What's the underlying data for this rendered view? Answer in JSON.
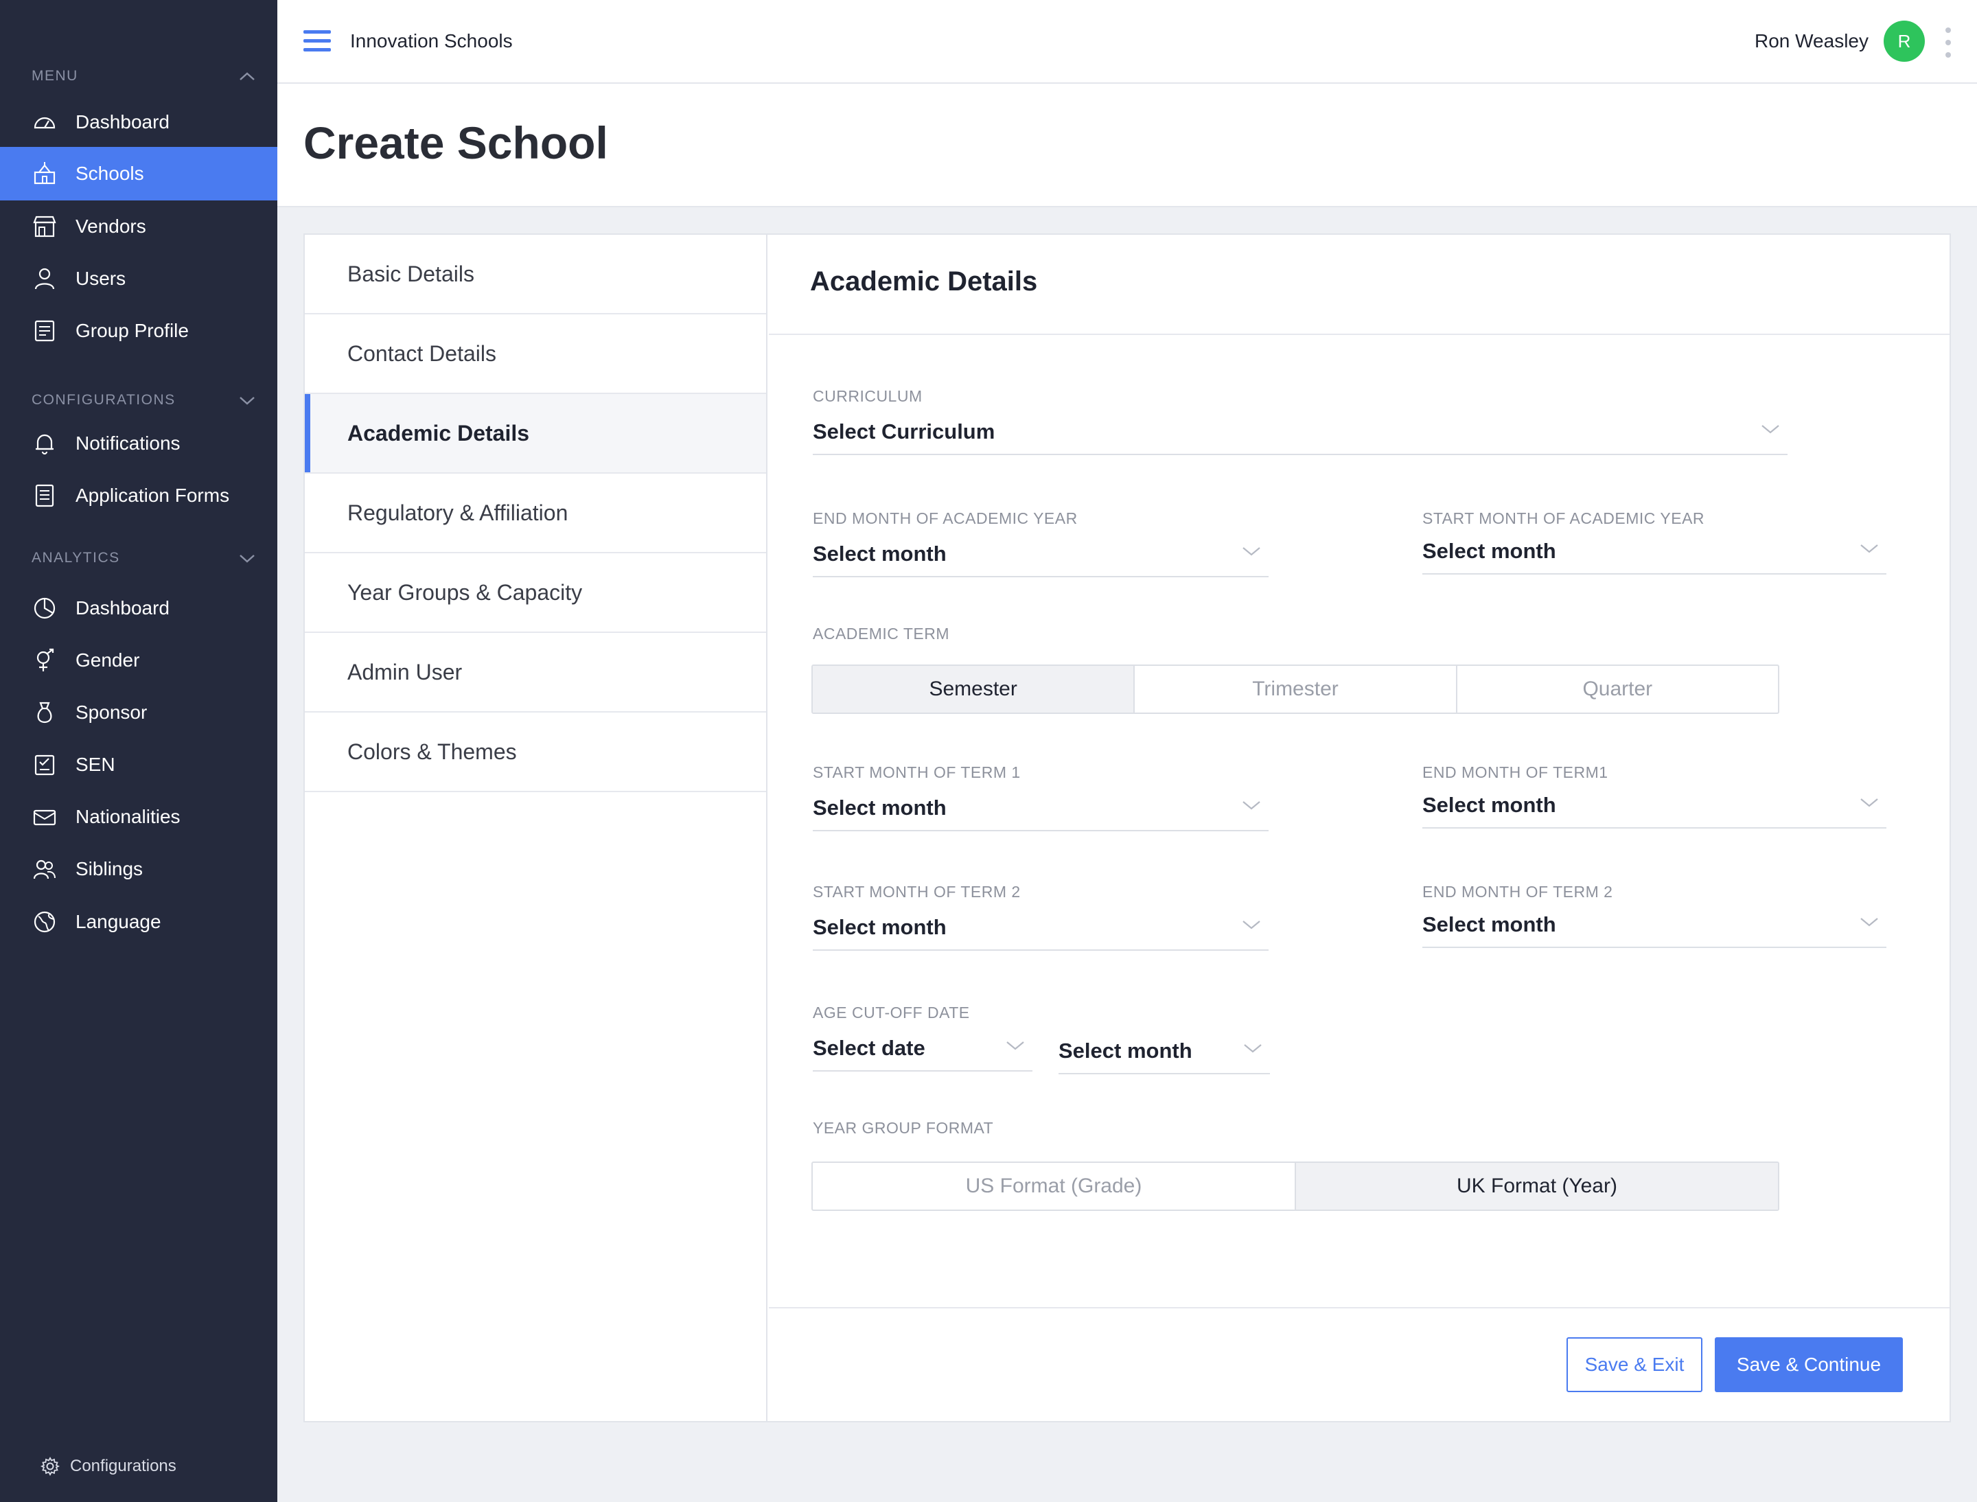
{
  "sidebar": {
    "menu_label": "MENU",
    "menu_items": [
      {
        "label": "Dashboard",
        "icon": "dashboard-icon"
      },
      {
        "label": "Schools",
        "icon": "school-icon",
        "active": true
      },
      {
        "label": "Vendors",
        "icon": "store-icon"
      },
      {
        "label": "Users",
        "icon": "user-icon"
      },
      {
        "label": "Group Profile",
        "icon": "profile-icon"
      }
    ],
    "config_label": "CONFIGURATIONS",
    "config_items": [
      {
        "label": "Notifications",
        "icon": "bell-icon"
      },
      {
        "label": "Application Forms",
        "icon": "form-icon"
      }
    ],
    "analytics_label": "ANALYTICS",
    "analytics_items": [
      {
        "label": "Dashboard",
        "icon": "pie-chart-icon"
      },
      {
        "label": "Gender",
        "icon": "gender-icon"
      },
      {
        "label": "Sponsor",
        "icon": "sponsor-icon"
      },
      {
        "label": "SEN",
        "icon": "sen-icon"
      },
      {
        "label": "Nationalities",
        "icon": "passport-icon"
      },
      {
        "label": "Siblings",
        "icon": "siblings-icon"
      },
      {
        "label": "Language",
        "icon": "globe-icon"
      }
    ],
    "footer_label": "Configurations"
  },
  "topbar": {
    "org_name": "Innovation Schools",
    "user_name": "Ron Weasley",
    "avatar_initial": "R"
  },
  "page": {
    "title": "Create School"
  },
  "steps": [
    {
      "label": "Basic Details"
    },
    {
      "label": "Contact Details"
    },
    {
      "label": "Academic Details",
      "active": true
    },
    {
      "label": "Regulatory & Affiliation"
    },
    {
      "label": "Year Groups & Capacity"
    },
    {
      "label": "Admin User"
    },
    {
      "label": "Colors & Themes"
    }
  ],
  "panel": {
    "title": "Academic Details",
    "curriculum": {
      "label": "CURRICULUM",
      "value": "Select Curriculum"
    },
    "end_month_year": {
      "label": "END MONTH OF ACADEMIC YEAR",
      "value": "Select month"
    },
    "start_month_year": {
      "label": "START MONTH OF ACADEMIC YEAR",
      "value": "Select month"
    },
    "academic_term": {
      "label": "ACADEMIC TERM",
      "options": [
        "Semester",
        "Trimester",
        "Quarter"
      ],
      "selected": "Semester"
    },
    "start_term1": {
      "label": "START MONTH OF TERM 1",
      "value": "Select month"
    },
    "end_term1": {
      "label": "END MONTH OF TERM1",
      "value": "Select month"
    },
    "start_term2": {
      "label": "START MONTH OF TERM 2",
      "value": "Select month"
    },
    "end_term2": {
      "label": "END MONTH OF TERM 2",
      "value": "Select month"
    },
    "age_cutoff": {
      "label": "AGE CUT-OFF DATE",
      "date_value": "Select date",
      "month_value": "Select month"
    },
    "year_group_format": {
      "label": "YEAR GROUP FORMAT",
      "options": [
        "US Format (Grade)",
        "UK Format (Year)"
      ],
      "selected": "UK Format (Year)"
    },
    "save_exit": "Save & Exit",
    "save_continue": "Save & Continue"
  },
  "colors": {
    "accent": "#4a7bf0",
    "sidebar_bg": "#252a3d",
    "avatar": "#2ec45c"
  }
}
